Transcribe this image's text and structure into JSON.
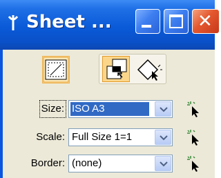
{
  "window": {
    "title": "Sheet ...",
    "buttons": {
      "minimize": "minimize-icon",
      "maximize": "maximize-icon",
      "close": "close-icon"
    }
  },
  "toolbar": {
    "icons": [
      "sheet-border-icon",
      "sheet-size-icon",
      "pick-sheet-icon"
    ]
  },
  "fields": {
    "size": {
      "label": "Size:",
      "value": "ISO A3"
    },
    "scale": {
      "label": "Scale:",
      "value": "Full Size 1=1"
    },
    "border": {
      "label": "Border:",
      "value": "(none)"
    }
  },
  "colors": {
    "titlebar": "#0a5ad8",
    "panel": "#ece9d8",
    "selection": "#316ac5",
    "close": "#e4572e"
  }
}
